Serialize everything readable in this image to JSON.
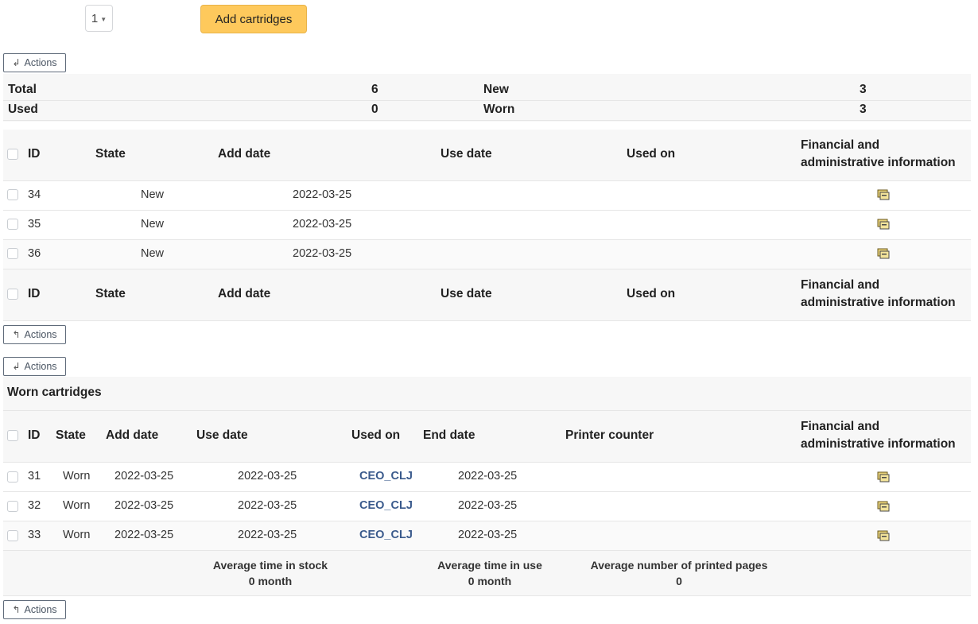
{
  "top": {
    "quantity": "1",
    "add_button": "Add cartridges"
  },
  "actions_label": "Actions",
  "summary": {
    "total_label": "Total",
    "total_value": "6",
    "new_label": "New",
    "new_value": "3",
    "used_label": "Used",
    "used_value": "0",
    "worn_label": "Worn",
    "worn_value": "3"
  },
  "new_table": {
    "headers": {
      "id": "ID",
      "state": "State",
      "add_date": "Add date",
      "use_date": "Use date",
      "used_on": "Used on",
      "fin_1": "Financial and",
      "fin_2": "administrative information"
    },
    "rows": [
      {
        "id": "34",
        "state": "New",
        "add_date": "2022-03-25"
      },
      {
        "id": "35",
        "state": "New",
        "add_date": "2022-03-25"
      },
      {
        "id": "36",
        "state": "New",
        "add_date": "2022-03-25"
      }
    ]
  },
  "worn_table": {
    "title": "Worn cartridges",
    "headers": {
      "id": "ID",
      "state": "State",
      "add_date": "Add date",
      "use_date": "Use date",
      "used_on": "Used on",
      "end_date": "End date",
      "printer_counter": "Printer counter",
      "fin_1": "Financial and",
      "fin_2": "administrative information"
    },
    "rows": [
      {
        "id": "31",
        "state": "Worn",
        "add_date": "2022-03-25",
        "use_date": "2022-03-25",
        "used_on": "CEO_CLJ",
        "end_date": "2022-03-25"
      },
      {
        "id": "32",
        "state": "Worn",
        "add_date": "2022-03-25",
        "use_date": "2022-03-25",
        "used_on": "CEO_CLJ",
        "end_date": "2022-03-25"
      },
      {
        "id": "33",
        "state": "Worn",
        "add_date": "2022-03-25",
        "use_date": "2022-03-25",
        "used_on": "CEO_CLJ",
        "end_date": "2022-03-25"
      }
    ],
    "footer": {
      "avg_stock_label": "Average time in stock",
      "avg_stock_value": "0 month",
      "avg_use_label": "Average time in use",
      "avg_use_value": "0 month",
      "avg_pages_label": "Average number of printed pages",
      "avg_pages_value": "0"
    }
  },
  "icons": {
    "actions_top": "arrow-down-left-icon",
    "actions_bottom": "arrow-up-left-icon",
    "financial": "financial-info-icon"
  }
}
